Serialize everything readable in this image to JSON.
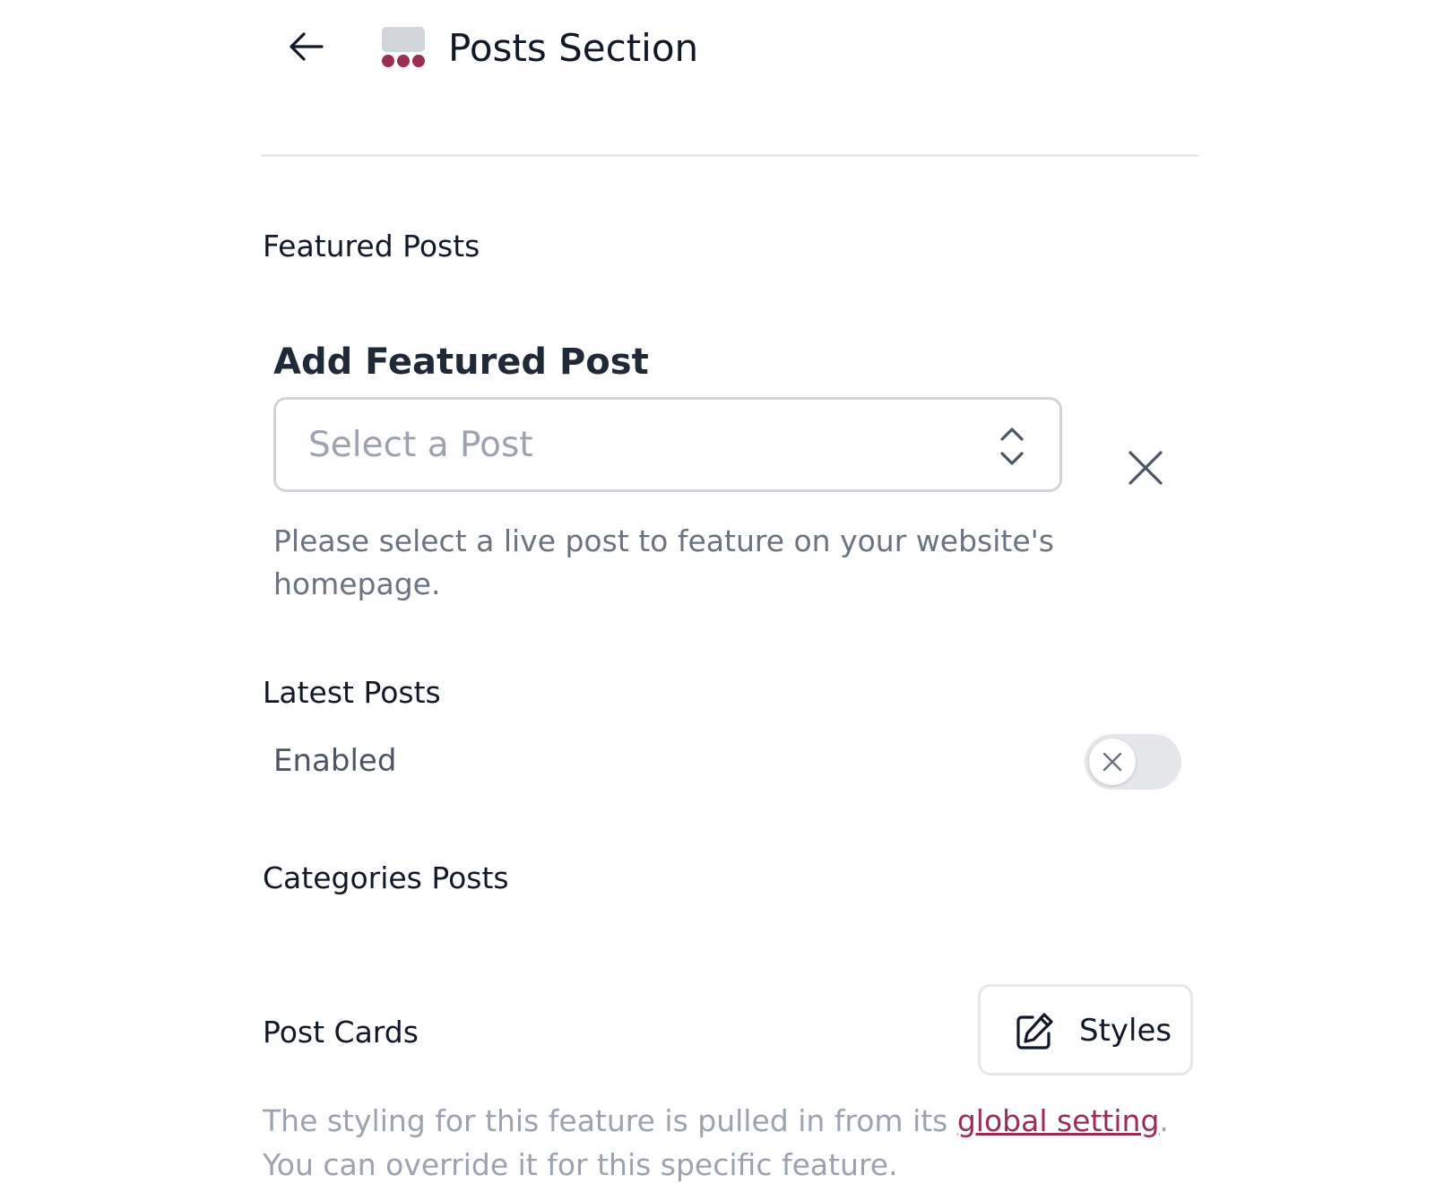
{
  "header": {
    "title": "Posts Section",
    "back_icon": "arrow-left-icon",
    "section_icon": "posts-section-icon"
  },
  "colors": {
    "accent": "#9b2d55",
    "icon_gray": "#d1d5db",
    "divider": "#e5e7eb",
    "muted_text": "#9ca3af"
  },
  "featured_posts": {
    "heading": "Featured Posts",
    "add_label": "Add Featured Post",
    "select": {
      "placeholder": "Select a Post",
      "icon": "chevron-up-down-icon"
    },
    "clear_icon": "close-icon",
    "help_text": "Please select a live post to feature on your website's homepage."
  },
  "latest_posts": {
    "heading": "Latest Posts",
    "toggle_label": "Enabled",
    "toggle_state": "off"
  },
  "categories_posts": {
    "heading": "Categories Posts"
  },
  "post_cards": {
    "heading": "Post Cards",
    "styles_button": {
      "label": "Styles",
      "icon": "edit-icon"
    },
    "note_prefix": "The styling for this feature is pulled in from its ",
    "note_link": "global setting",
    "note_suffix": ". You can override it for this specific feature."
  }
}
